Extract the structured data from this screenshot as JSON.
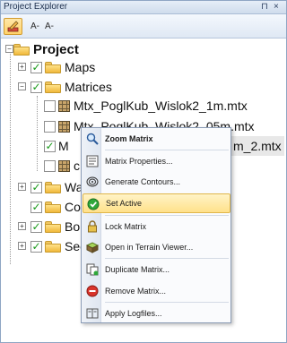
{
  "panel": {
    "title": "Project Explorer",
    "pin_glyph": "⊓",
    "close_glyph": "×"
  },
  "toolbar": {
    "btn1_icon": "edit-icon",
    "btn2_label": "A-",
    "btn3_label": "A-"
  },
  "tree": {
    "root": "Project",
    "maps": "Maps",
    "matrices": "Matrices",
    "m1": "Mtx_PoglKub_Wislok2_1m.mtx",
    "m2": "Mtx_PoglKub_Wislok2_05m.mtx",
    "m3_left": "M",
    "m3_right": "m_2.mtx",
    "m4": "c",
    "wa": "Wa",
    "co": "Co",
    "bo": "Bou",
    "se": "Sec"
  },
  "context_menu": {
    "items": [
      {
        "label": "Zoom Matrix",
        "icon": "zoom-icon"
      },
      {
        "label": "Matrix Properties..."
      },
      {
        "label": "Generate Contours..."
      },
      {
        "label": "Set Active"
      },
      {
        "label": "Lock Matrix"
      },
      {
        "label": "Open in Terrain Viewer..."
      },
      {
        "label": "Duplicate Matrix..."
      },
      {
        "label": "Remove Matrix..."
      },
      {
        "label": "Apply Logfiles..."
      }
    ]
  },
  "colors": {
    "accent": "#ffd36b",
    "check": "#1a9a1a",
    "folder": "#f0b83a"
  }
}
